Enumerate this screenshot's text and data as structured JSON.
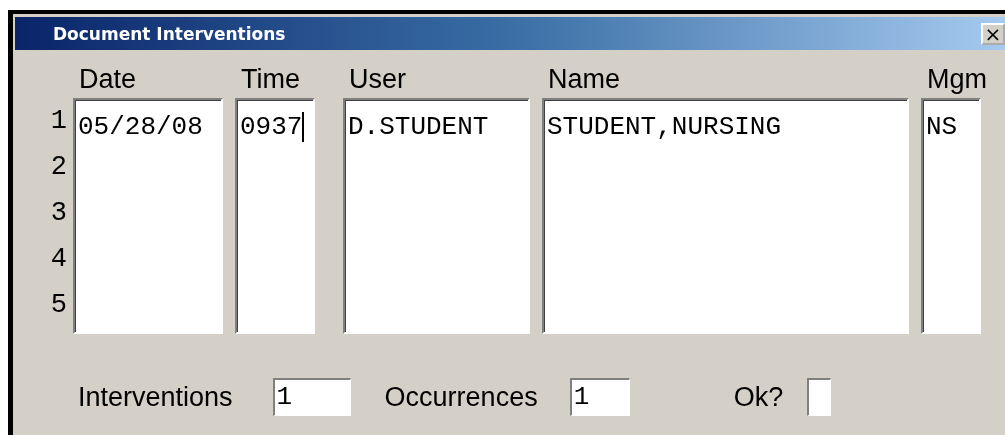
{
  "window": {
    "title": "Document Interventions",
    "close_label": "×"
  },
  "row_numbers": [
    "1",
    "2",
    "3",
    "4",
    "5"
  ],
  "columns": [
    {
      "header": "Date",
      "values": [
        "05/28/08"
      ],
      "focused": false
    },
    {
      "header": "Time",
      "values": [
        "0937"
      ],
      "focused": true
    },
    {
      "header": "User",
      "values": [
        "D.STUDENT"
      ],
      "focused": false
    },
    {
      "header": "Name",
      "values": [
        "STUDENT,NURSING"
      ],
      "focused": false
    },
    {
      "header": "Mgm",
      "values": [
        "NS"
      ],
      "focused": false
    }
  ],
  "footer": [
    {
      "label": "Interventions",
      "value": "1"
    },
    {
      "label": "Occurrences",
      "value": "1"
    },
    {
      "label": "Ok?"
    }
  ]
}
